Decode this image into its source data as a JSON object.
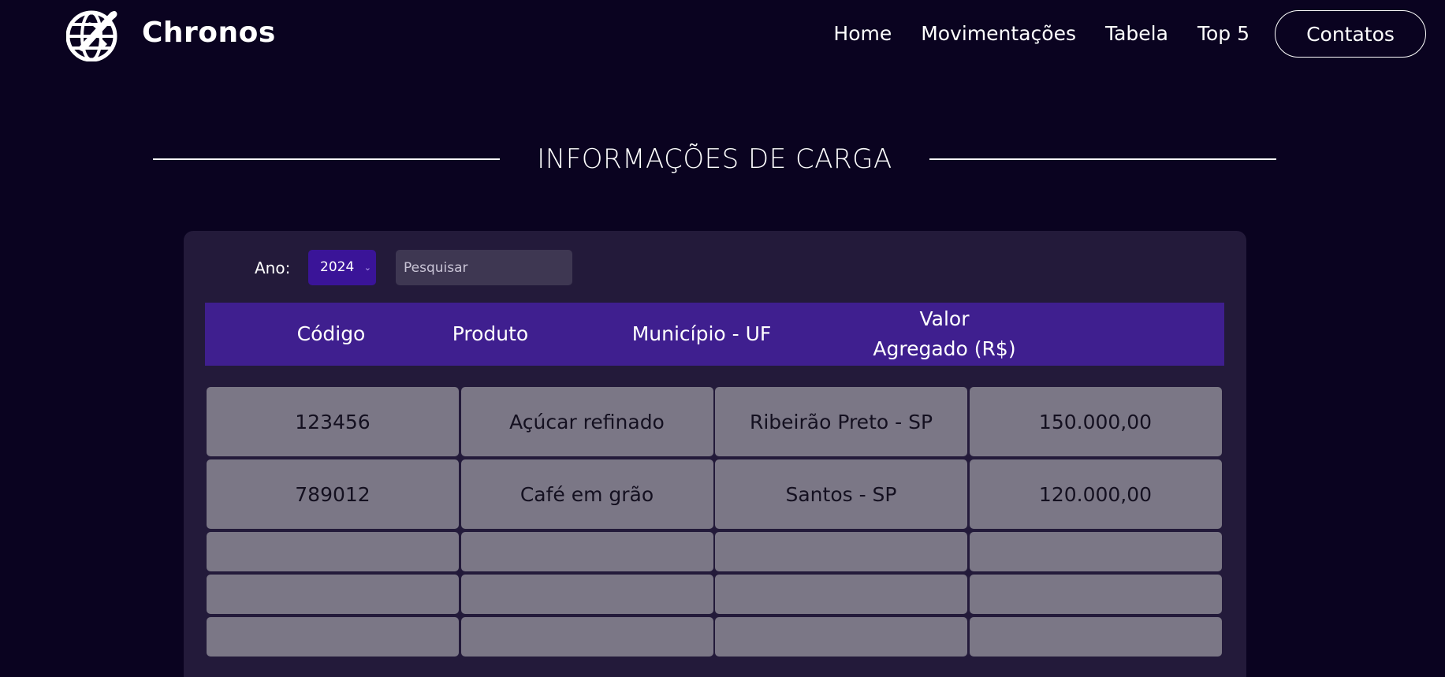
{
  "header": {
    "brand": "Chronos",
    "logo_icon": "globe-airplane-icon",
    "nav": {
      "home": "Home",
      "movimentacoes": "Movimentações",
      "tabela": "Tabela",
      "top5": "Top 5",
      "contatos": "Contatos"
    }
  },
  "section": {
    "title": "INFORMAÇÕES DE CARGA"
  },
  "filters": {
    "year_label": "Ano:",
    "year_value": "2024",
    "search_placeholder": "Pesquisar"
  },
  "table": {
    "headers": {
      "codigo": "Código",
      "produto": "Produto",
      "municipio": "Município - UF",
      "valor_line1": "Valor",
      "valor_line2": "Agregado (R$)"
    },
    "rows": [
      {
        "codigo": "123456",
        "produto": "Açúcar refinado",
        "municipio": "Ribeirão Preto - SP",
        "valor": "150.000,00"
      },
      {
        "codigo": "789012",
        "produto": "Café em grão",
        "municipio": "Santos - SP",
        "valor": "120.000,00"
      }
    ]
  },
  "colors": {
    "background": "#0a0320",
    "panel": "#231a3a",
    "header_row": "#3f1f8f",
    "select": "#3a1498",
    "cell": "#7b7786"
  }
}
